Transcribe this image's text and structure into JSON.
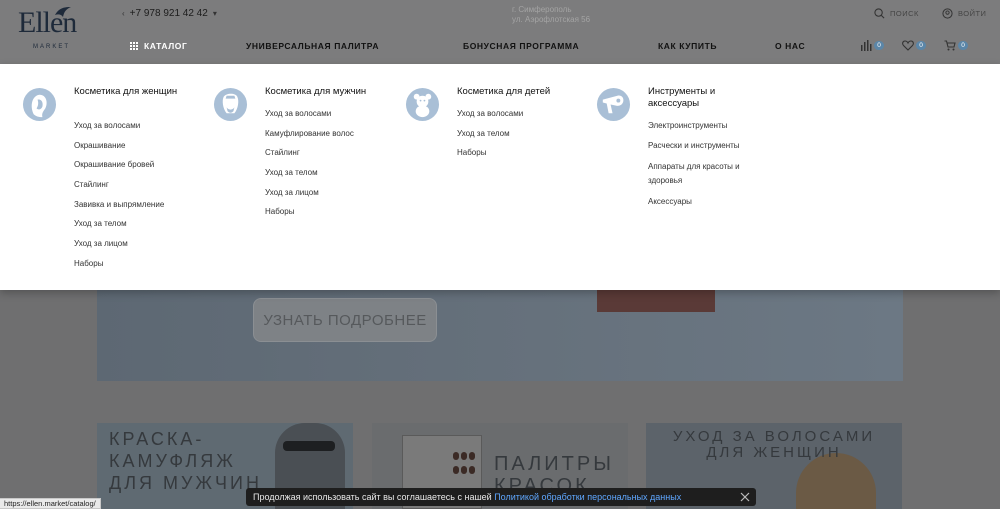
{
  "header": {
    "logo_text": "Ellen",
    "logo_sub": "MARKET",
    "phone": "+7 978 921 42 42",
    "address_line1": "г. Симферополь",
    "address_line2": "ул. Аэрофлотская 56",
    "search_label": "ПОИСК",
    "login_label": "ВОЙТИ"
  },
  "nav": {
    "catalog": "КАТАЛОГ",
    "palette": "УНИВЕРСАЛЬНАЯ ПАЛИТРА",
    "bonus": "БОНУСНАЯ ПРОГРАММА",
    "how_to_buy": "КАК КУПИТЬ",
    "about": "О НАС",
    "compare_count": "0",
    "favorites_count": "0",
    "cart_count": "0"
  },
  "menu": {
    "women": {
      "title": "Косметика для женщин",
      "icon": "woman-face-icon",
      "links": [
        "Уход за волосами",
        "Окрашивание",
        "Окрашивание бровей",
        "Стайлинг",
        "Завивка и выпрямление",
        "Уход за телом",
        "Уход за лицом",
        "Наборы"
      ]
    },
    "men": {
      "title": "Косметика для мужчин",
      "icon": "man-face-icon",
      "links": [
        "Уход за волосами",
        "Камуфлирование волос",
        "Стайлинг",
        "Уход за телом",
        "Уход за лицом",
        "Наборы"
      ]
    },
    "kids": {
      "title": "Косметика для детей",
      "icon": "teddy-bear-icon",
      "links": [
        "Уход за волосами",
        "Уход за телом",
        "Наборы"
      ]
    },
    "tools": {
      "title": "Инструменты и аксессуары",
      "icon": "hair-dryer-icon",
      "links": [
        "Электроинструменты",
        "Расчески и инструменты",
        "Аппараты для красоты и здоровья",
        "Аксессуары"
      ]
    }
  },
  "banner": {
    "button_label": "УЗНАТЬ ПОДРОБНЕЕ"
  },
  "tiles": [
    {
      "text": "КРАСКА-КАМУФЛЯЖ ДЛЯ МУЖЧИН"
    },
    {
      "text": "ПАЛИТРЫ КРАСОК"
    },
    {
      "text": "УХОД ЗА ВОЛОСАМИ ДЛЯ ЖЕНЩИН"
    }
  ],
  "status_url": "https://ellen.market/catalog/",
  "cookie": {
    "text": "Продолжая использовать сайт вы соглашаетесь с нашей ",
    "link": "Политикой обработки персональных данных"
  },
  "colors": {
    "accent": "#5b86a8",
    "overlay_header": "#7c7c7d",
    "menu_bg": "#ffffff",
    "cookie_bg": "#1e1e1e",
    "cookie_link": "#5fa7ff"
  }
}
